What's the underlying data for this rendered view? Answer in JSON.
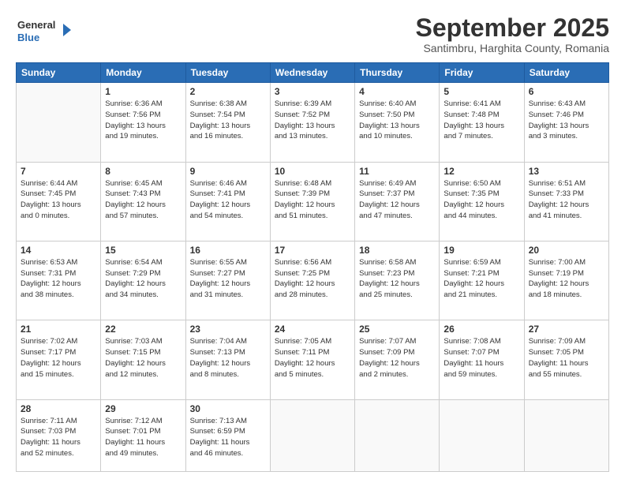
{
  "header": {
    "logo_line1": "General",
    "logo_line2": "Blue",
    "month": "September 2025",
    "location": "Santimbru, Harghita County, Romania"
  },
  "weekdays": [
    "Sunday",
    "Monday",
    "Tuesday",
    "Wednesday",
    "Thursday",
    "Friday",
    "Saturday"
  ],
  "weeks": [
    [
      {
        "day": "",
        "info": ""
      },
      {
        "day": "1",
        "info": "Sunrise: 6:36 AM\nSunset: 7:56 PM\nDaylight: 13 hours\nand 19 minutes."
      },
      {
        "day": "2",
        "info": "Sunrise: 6:38 AM\nSunset: 7:54 PM\nDaylight: 13 hours\nand 16 minutes."
      },
      {
        "day": "3",
        "info": "Sunrise: 6:39 AM\nSunset: 7:52 PM\nDaylight: 13 hours\nand 13 minutes."
      },
      {
        "day": "4",
        "info": "Sunrise: 6:40 AM\nSunset: 7:50 PM\nDaylight: 13 hours\nand 10 minutes."
      },
      {
        "day": "5",
        "info": "Sunrise: 6:41 AM\nSunset: 7:48 PM\nDaylight: 13 hours\nand 7 minutes."
      },
      {
        "day": "6",
        "info": "Sunrise: 6:43 AM\nSunset: 7:46 PM\nDaylight: 13 hours\nand 3 minutes."
      }
    ],
    [
      {
        "day": "7",
        "info": "Sunrise: 6:44 AM\nSunset: 7:45 PM\nDaylight: 13 hours\nand 0 minutes."
      },
      {
        "day": "8",
        "info": "Sunrise: 6:45 AM\nSunset: 7:43 PM\nDaylight: 12 hours\nand 57 minutes."
      },
      {
        "day": "9",
        "info": "Sunrise: 6:46 AM\nSunset: 7:41 PM\nDaylight: 12 hours\nand 54 minutes."
      },
      {
        "day": "10",
        "info": "Sunrise: 6:48 AM\nSunset: 7:39 PM\nDaylight: 12 hours\nand 51 minutes."
      },
      {
        "day": "11",
        "info": "Sunrise: 6:49 AM\nSunset: 7:37 PM\nDaylight: 12 hours\nand 47 minutes."
      },
      {
        "day": "12",
        "info": "Sunrise: 6:50 AM\nSunset: 7:35 PM\nDaylight: 12 hours\nand 44 minutes."
      },
      {
        "day": "13",
        "info": "Sunrise: 6:51 AM\nSunset: 7:33 PM\nDaylight: 12 hours\nand 41 minutes."
      }
    ],
    [
      {
        "day": "14",
        "info": "Sunrise: 6:53 AM\nSunset: 7:31 PM\nDaylight: 12 hours\nand 38 minutes."
      },
      {
        "day": "15",
        "info": "Sunrise: 6:54 AM\nSunset: 7:29 PM\nDaylight: 12 hours\nand 34 minutes."
      },
      {
        "day": "16",
        "info": "Sunrise: 6:55 AM\nSunset: 7:27 PM\nDaylight: 12 hours\nand 31 minutes."
      },
      {
        "day": "17",
        "info": "Sunrise: 6:56 AM\nSunset: 7:25 PM\nDaylight: 12 hours\nand 28 minutes."
      },
      {
        "day": "18",
        "info": "Sunrise: 6:58 AM\nSunset: 7:23 PM\nDaylight: 12 hours\nand 25 minutes."
      },
      {
        "day": "19",
        "info": "Sunrise: 6:59 AM\nSunset: 7:21 PM\nDaylight: 12 hours\nand 21 minutes."
      },
      {
        "day": "20",
        "info": "Sunrise: 7:00 AM\nSunset: 7:19 PM\nDaylight: 12 hours\nand 18 minutes."
      }
    ],
    [
      {
        "day": "21",
        "info": "Sunrise: 7:02 AM\nSunset: 7:17 PM\nDaylight: 12 hours\nand 15 minutes."
      },
      {
        "day": "22",
        "info": "Sunrise: 7:03 AM\nSunset: 7:15 PM\nDaylight: 12 hours\nand 12 minutes."
      },
      {
        "day": "23",
        "info": "Sunrise: 7:04 AM\nSunset: 7:13 PM\nDaylight: 12 hours\nand 8 minutes."
      },
      {
        "day": "24",
        "info": "Sunrise: 7:05 AM\nSunset: 7:11 PM\nDaylight: 12 hours\nand 5 minutes."
      },
      {
        "day": "25",
        "info": "Sunrise: 7:07 AM\nSunset: 7:09 PM\nDaylight: 12 hours\nand 2 minutes."
      },
      {
        "day": "26",
        "info": "Sunrise: 7:08 AM\nSunset: 7:07 PM\nDaylight: 11 hours\nand 59 minutes."
      },
      {
        "day": "27",
        "info": "Sunrise: 7:09 AM\nSunset: 7:05 PM\nDaylight: 11 hours\nand 55 minutes."
      }
    ],
    [
      {
        "day": "28",
        "info": "Sunrise: 7:11 AM\nSunset: 7:03 PM\nDaylight: 11 hours\nand 52 minutes."
      },
      {
        "day": "29",
        "info": "Sunrise: 7:12 AM\nSunset: 7:01 PM\nDaylight: 11 hours\nand 49 minutes."
      },
      {
        "day": "30",
        "info": "Sunrise: 7:13 AM\nSunset: 6:59 PM\nDaylight: 11 hours\nand 46 minutes."
      },
      {
        "day": "",
        "info": ""
      },
      {
        "day": "",
        "info": ""
      },
      {
        "day": "",
        "info": ""
      },
      {
        "day": "",
        "info": ""
      }
    ]
  ]
}
